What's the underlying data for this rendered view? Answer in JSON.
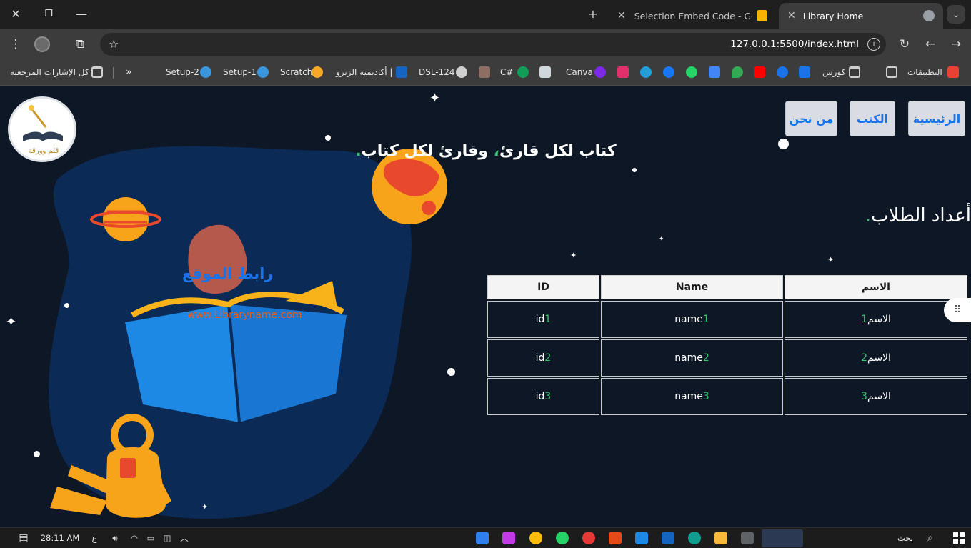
{
  "browser": {
    "tabs": [
      {
        "title": "Selection Embed Code - Google",
        "active": false
      },
      {
        "title": "Library Home",
        "active": true
      }
    ],
    "new_tab_label": "+",
    "url": "127.0.0.1:5500/index.html",
    "window_controls": {
      "close": "✕",
      "restore": "❐",
      "minimize": "—"
    }
  },
  "bookmarks": [
    {
      "label": "التطبيقات",
      "icon": "apps-grid-icon",
      "color": "#e94235"
    },
    {
      "label": "كورس",
      "icon": "folder-icon",
      "color": "#cfcfcf"
    },
    {
      "label": "Canva",
      "icon": "canva-icon",
      "color": "#7d2ae8"
    },
    {
      "label": "C#",
      "icon": "csharp-icon",
      "color": "#0f9d58"
    },
    {
      "label": "DSL-124",
      "icon": "globe-icon",
      "color": "#cfcfcf"
    },
    {
      "label": "أكاديمية الزيرو |",
      "icon": "e-icon",
      "color": "#1565c0"
    },
    {
      "label": "Scratch",
      "icon": "scratch-icon",
      "color": "#f9a825"
    },
    {
      "label": "Setup-1",
      "icon": "vscode-icon",
      "color": "#3a96dd"
    },
    {
      "label": "Setup-2",
      "icon": "vscode-icon",
      "color": "#3a96dd"
    },
    {
      "label": "كل الإشارات المرجعية",
      "icon": "folder-icon",
      "color": "#cfcfcf"
    }
  ],
  "bookmarks_more": "»",
  "site": {
    "nav": [
      "الرئيسية",
      "الكتب",
      "من نحن"
    ],
    "slogan_parts": [
      "كتاب لكل قارئ",
      "، ",
      "وقارئ لكل كتاب",
      "."
    ],
    "logo_text": "قلم وورقة",
    "students_title": "أعداد الطلاب",
    "students_title_dot": ".",
    "site_link": "رابط الموقع",
    "site_url": "www.Libraryname.com",
    "table": {
      "headers": [
        "الاسم",
        "Name",
        "ID"
      ],
      "rows": [
        [
          {
            "text": "الاسم",
            "num": "1"
          },
          {
            "text": "name",
            "num": "1"
          },
          {
            "text": "id",
            "num": "1"
          }
        ],
        [
          {
            "text": "الاسم",
            "num": "2"
          },
          {
            "text": "name",
            "num": "2"
          },
          {
            "text": "id",
            "num": "2"
          }
        ],
        [
          {
            "text": "الاسم",
            "num": "3"
          },
          {
            "text": "name",
            "num": "3"
          },
          {
            "text": "id",
            "num": "3"
          }
        ]
      ]
    }
  },
  "taskbar": {
    "search_label": "بحث",
    "time": "28:11 AM",
    "lang": "ع"
  },
  "colors": {
    "page_bg": "#0d1726",
    "accent_green": "#38c172",
    "nav_text": "#1a73e8",
    "url_orange": "#e85d1e"
  }
}
